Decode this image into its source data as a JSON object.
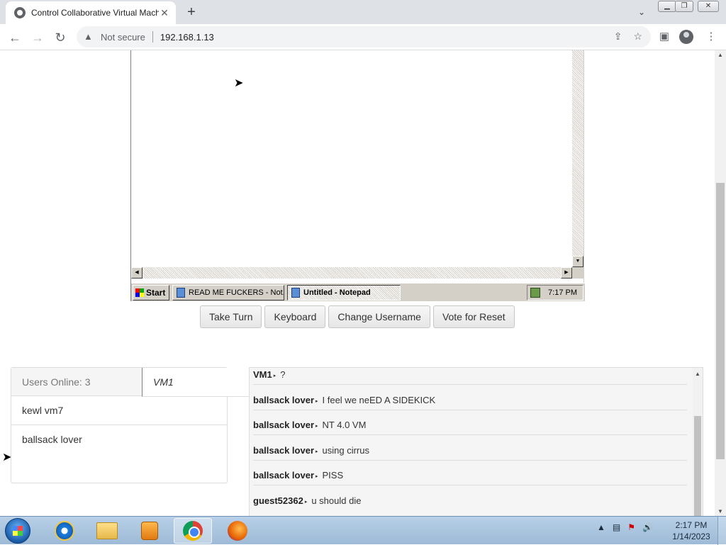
{
  "browser": {
    "tab_title": "Control Collaborative Virtual Machine",
    "new_tab": "+",
    "not_secure": "Not secure",
    "url": "192.168.1.13"
  },
  "vm": {
    "taskbar": {
      "start": "Start",
      "items": [
        {
          "label": "READ ME FUCKERS - Not..."
        },
        {
          "label": "Untitled - Notepad"
        }
      ],
      "clock": "7:17 PM"
    }
  },
  "controls": {
    "take_turn": "Take Turn",
    "keyboard": "Keyboard",
    "change_username": "Change Username",
    "vote_reset": "Vote for Reset"
  },
  "users": {
    "header": "Users Online: 3",
    "list": [
      {
        "name": "VM1"
      },
      {
        "name": "kewl vm7"
      },
      {
        "name": "ballsack lover"
      }
    ]
  },
  "chat": {
    "messages": [
      {
        "user": "VM1",
        "text": "?"
      },
      {
        "user": "ballsack lover",
        "text": "I feel we neED A SIDEKICK"
      },
      {
        "user": "ballsack lover",
        "text": "NT 4.0 VM"
      },
      {
        "user": "ballsack lover",
        "text": "using cirrus"
      },
      {
        "user": "ballsack lover",
        "text": "PISS"
      },
      {
        "user": "guest52362",
        "text": "u should die"
      }
    ]
  },
  "os_taskbar": {
    "time": "2:17 PM",
    "date": "1/14/2023"
  }
}
